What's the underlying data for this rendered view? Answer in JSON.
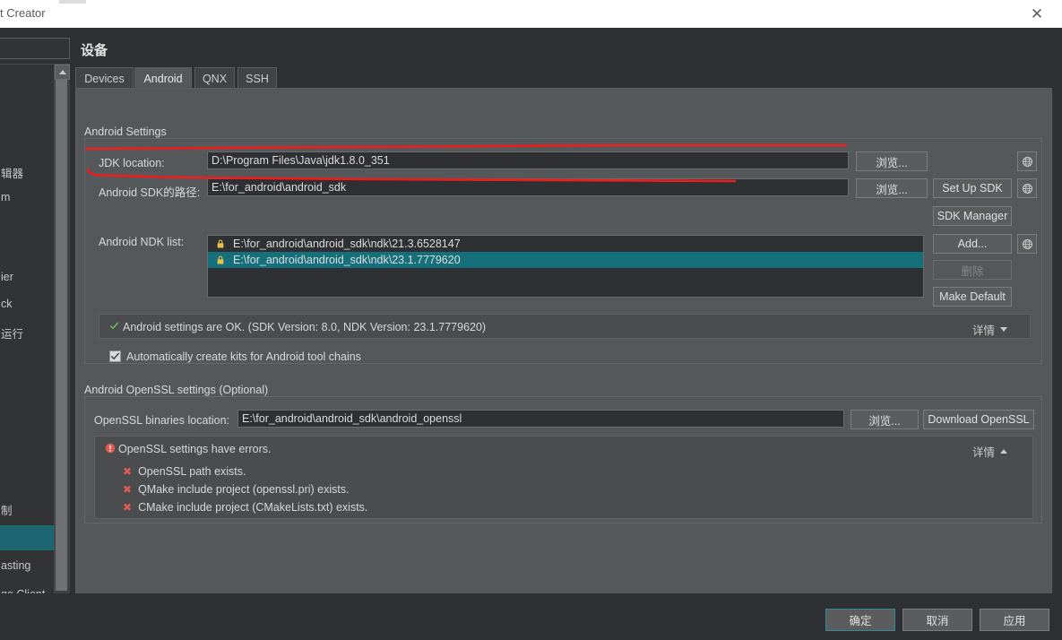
{
  "window": {
    "title": "t Creator",
    "close_icon": "close-icon"
  },
  "sidebar": {
    "search_placeholder": "",
    "items": [
      {
        "label": "辑器"
      },
      {
        "label": "m"
      },
      {
        "label": "ier"
      },
      {
        "label": "ck"
      },
      {
        "label": "运行"
      },
      {
        "label": "制"
      },
      {
        "label": ""
      },
      {
        "label": "asting"
      },
      {
        "label": "ge Client"
      }
    ]
  },
  "dialog": {
    "page_title": "设备",
    "tabs": [
      {
        "label": "Devices",
        "active": false
      },
      {
        "label": "Android",
        "active": true
      },
      {
        "label": "QNX",
        "active": false
      },
      {
        "label": "SSH",
        "active": false
      }
    ]
  },
  "android_settings": {
    "group_title": "Android Settings",
    "jdk_label": "JDK location:",
    "jdk_value": "D:\\Program Files\\Java\\jdk1.8.0_351",
    "jdk_browse": "浏览...",
    "sdk_label": "Android SDK的路径:",
    "sdk_value": "E:\\for_android\\android_sdk",
    "sdk_browse": "浏览...",
    "set_up_sdk": "Set Up SDK",
    "sdk_manager": "SDK Manager",
    "ndk_label": "Android NDK list:",
    "ndk_items": [
      {
        "path": "E:\\for_android\\android_sdk\\ndk\\21.3.6528147",
        "locked": true,
        "selected": false
      },
      {
        "path": "E:\\for_android\\android_sdk\\ndk\\23.1.7779620",
        "locked": true,
        "selected": true
      }
    ],
    "add_button": "Add...",
    "remove_button": "删除",
    "make_default_button": "Make Default",
    "status_text": "Android settings are OK. (SDK Version: 8.0, NDK Version: 23.1.7779620)",
    "status_icon": "check-icon",
    "status_color": "#6cbf5b",
    "details_label": "详情",
    "details_state": "collapsed",
    "autocreate_label": "Automatically create kits for Android tool chains",
    "autocreate_checked": true
  },
  "openssl_settings": {
    "group_title": "Android OpenSSL settings (Optional)",
    "binaries_label": "OpenSSL binaries location:",
    "binaries_value": "E:\\for_android\\android_sdk\\android_openssl",
    "browse_button": "浏览...",
    "download_button": "Download OpenSSL",
    "error_title": "OpenSSL settings have errors.",
    "error_icon": "error-icon",
    "error_color": "#e05a52",
    "details_label": "详情",
    "details_state": "expanded",
    "errors": [
      {
        "icon": "x-icon",
        "label": "OpenSSL path exists."
      },
      {
        "icon": "x-icon",
        "label": "QMake include project (openssl.pri) exists."
      },
      {
        "icon": "x-icon",
        "label": "CMake include project (CMakeLists.txt) exists."
      }
    ]
  },
  "footer": {
    "ok_label": "确定",
    "cancel_label": "取消",
    "apply_label": "应用"
  },
  "icons": {
    "globe": "globe-icon",
    "lock": "lock-icon"
  },
  "colors": {
    "accent_teal": "#15707c",
    "selection": "#1b6670",
    "annotation_red": "#f01c1c",
    "ok_green": "#6cbf5b",
    "error_red": "#e05a52",
    "panel_bg": "#55585a",
    "dialog_bg": "#2e3033"
  }
}
